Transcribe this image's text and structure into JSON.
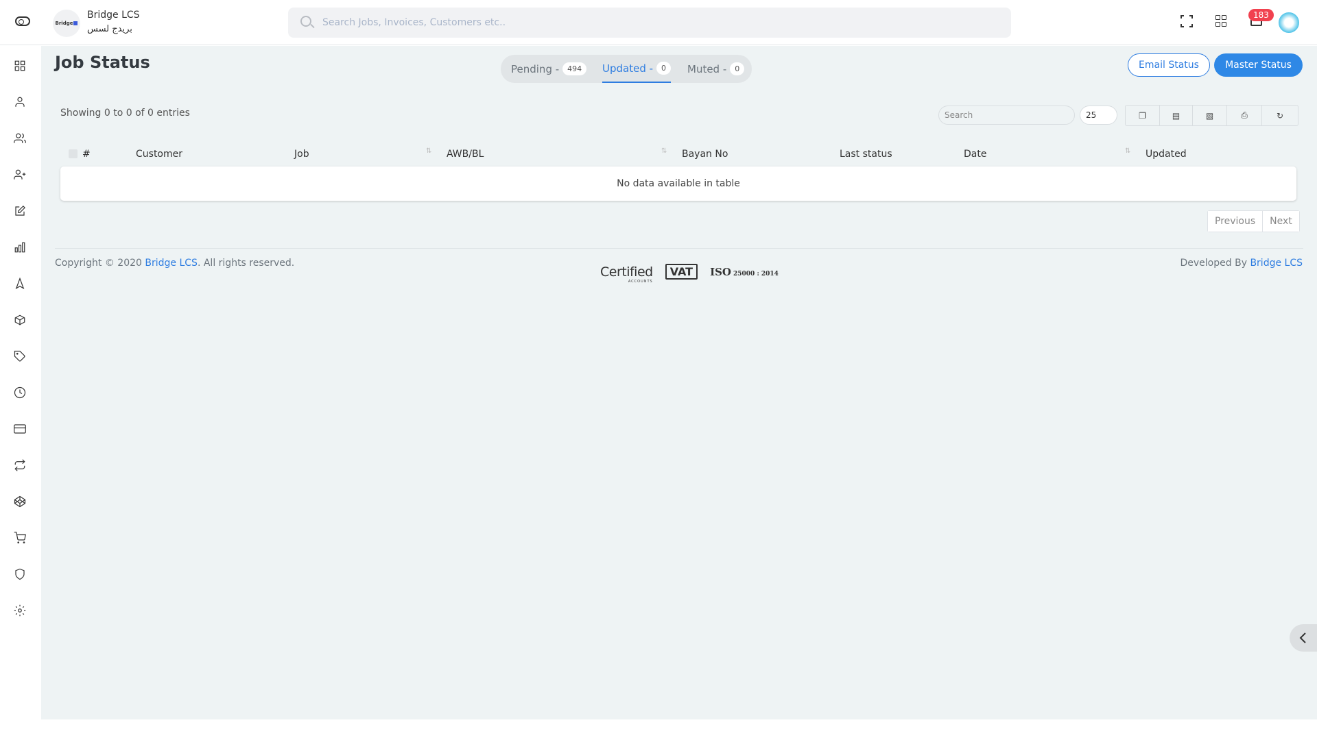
{
  "header": {
    "brand_name": "Bridge LCS",
    "brand_name_ar": "بريدج لسس",
    "logo_text": "Bridge",
    "search_placeholder": "Search Jobs, Invoices, Customers etc..",
    "notification_count": "183"
  },
  "sidebar": {
    "items": [
      {
        "icon": "dashboard-grid-icon"
      },
      {
        "icon": "user-icon"
      },
      {
        "icon": "users-icon"
      },
      {
        "icon": "user-plus-icon"
      },
      {
        "icon": "edit-icon"
      },
      {
        "icon": "bar-chart-icon"
      },
      {
        "icon": "navigation-icon"
      },
      {
        "icon": "package-icon"
      },
      {
        "icon": "tag-icon"
      },
      {
        "icon": "clock-icon"
      },
      {
        "icon": "credit-card-icon"
      },
      {
        "icon": "repeat-icon"
      },
      {
        "icon": "codepen-icon"
      },
      {
        "icon": "shopping-cart-icon"
      },
      {
        "icon": "shield-icon"
      },
      {
        "icon": "settings-icon"
      }
    ]
  },
  "page": {
    "title": "Job Status",
    "tabs": [
      {
        "label": "Pending - ",
        "count": "494",
        "active": false
      },
      {
        "label": "Updated - ",
        "count": "0",
        "active": true
      },
      {
        "label": "Muted - ",
        "count": "0",
        "active": false
      }
    ],
    "email_status_label": "Email Status",
    "master_status_label": "Master Status"
  },
  "table": {
    "info": "Showing 0 to 0 of 0 entries",
    "search_placeholder": "Search",
    "page_length": "25",
    "export_buttons": [
      "copy-icon",
      "csv-icon",
      "excel-icon",
      "print-icon",
      "refresh-icon"
    ],
    "columns": [
      "#",
      "Customer",
      "Job",
      "AWB/BL",
      "Bayan No",
      "Last status",
      "Date",
      "Updated"
    ],
    "empty_message": "No data available in table",
    "pager": {
      "previous": "Previous",
      "next": "Next"
    }
  },
  "footer": {
    "copyright_prefix": "Copyright © 2020 ",
    "copyright_link": "Bridge LCS",
    "copyright_suffix": ". All rights reserved.",
    "badges": {
      "certified": "Certified",
      "certified_sub": "ACCOUNTS",
      "vat": "VAT",
      "iso": "ISO",
      "iso_std": "25000 : 2014"
    },
    "developed_prefix": "Developed By ",
    "developed_link": "Bridge LCS"
  }
}
